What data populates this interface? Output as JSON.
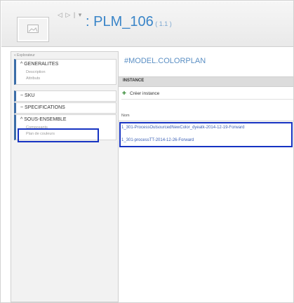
{
  "header": {
    "nav_arrows": "◁ ▷",
    "nav_sep": "|",
    "nav_dropdown": "▾",
    "title": ": PLM_106",
    "version": " ( 1.1 )"
  },
  "sidebar": {
    "title": "« Explorateur",
    "groups": [
      {
        "label": "^ GENERALITES",
        "items": [
          "Description",
          "Attributs"
        ]
      },
      {
        "label": "~ SKU",
        "items": []
      },
      {
        "label": "~ SPECIFICATIONS",
        "items": []
      },
      {
        "label": "^ SOUS-ENSEMBLE",
        "items": [
          "Composants",
          "Plan de couleurs"
        ]
      }
    ]
  },
  "main": {
    "model_title": "#MODEL.COLORPLAN",
    "section_title": "INSTANCE",
    "create_label": "Créer instance",
    "column_name": "Nom",
    "rows": [
      "1_301-ProcessOutsourcedNewColor_dyeatk-2014-12-19-Forward",
      "1_301-processTT-2014-12-26-Forward"
    ]
  },
  "colors": {
    "accent": "#3a85c8",
    "highlight": "#1633c2",
    "link": "#3a5fb5"
  }
}
